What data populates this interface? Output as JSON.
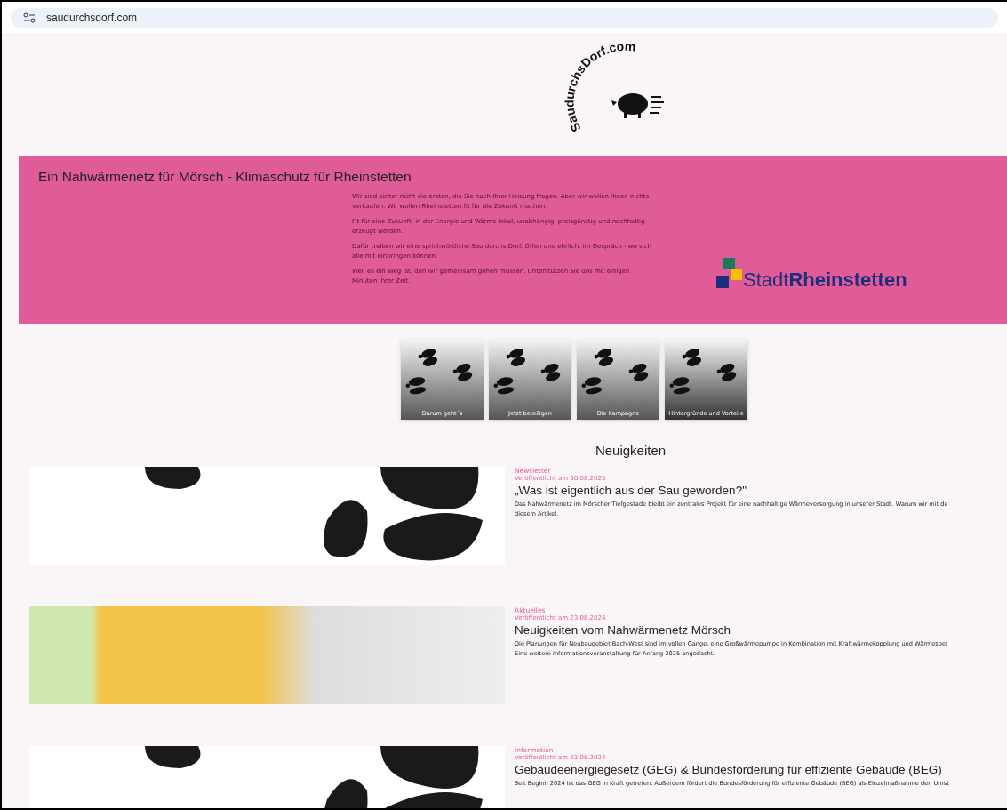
{
  "browser": {
    "url": "saudurchsdorf.com"
  },
  "logo": {
    "text": "SaudurchsDorf.com"
  },
  "banner": {
    "title": "Ein Nahwärmenetz für Mörsch - Klimaschutz für Rheinstetten",
    "paragraphs": [
      "Wir sind sicher nicht die ersten, die Sie nach Ihrer Heizung fragen. Aber wir wollen Ihnen nichts verkaufen. Wir wollen Rheinstetten fit für die Zukunft machen.",
      "Fit für eine Zukunft, in der Energie und Wärme lokal, unabhängig, preisgünstig und nachhaltig erzeugt werden.",
      "Dafür treiben wir eine sprichwörtliche Sau durchs Dorf. Offen und ehrlich, im Gespräch - wo sich alle mit einbringen können.",
      "Weil es ein Weg ist, den wir gemeinsam gehen müssen. Unterstützen Sie uns mit einigen Minuten Ihrer Zeit."
    ],
    "partner_logo": "Stadt**Rheinstetten**"
  },
  "tiles": [
    "Darum geht´s",
    "Jetzt beteiligen",
    "Die Kampagne",
    "Hintergründe und Vorteile"
  ],
  "news": {
    "heading": "Neuigkeiten",
    "items": [
      {
        "kind": "hoofprints",
        "category": "Newsletter",
        "date": "Veröffentlicht am 30.08.2025",
        "title": "„Was ist eigentlich aus der Sau geworden?\"",
        "lines": [
          "Das Nahwärmenetz im Mörscher Tiefgestade bleibt ein zentrales Projekt für eine nachhaltige Wärmeversorgung in unserer Stadt. Warum wir mit de",
          "diesem Artikel."
        ]
      },
      {
        "kind": "map",
        "category": "Aktuelles",
        "date": "Veröffentlicht am 23.08.2024",
        "title": "Neuigkeiten vom Nahwärmenetz Mörsch",
        "lines": [
          "Die Planungen für Neubaugebiet Bach-West sind im vollen Gange, eine Großwärmepumpe in Kombination mit Kraftwärmekopplung und Wärmespei",
          "Eine weitere Informationsveranstaltung für Anfang 2025 angedacht."
        ]
      },
      {
        "kind": "hoofprints",
        "category": "Information",
        "date": "Veröffentlicht am 23.08.2024",
        "title": "Gebäudeenergiegesetz (GEG) & Bundesförderung für effiziente Gebäude (BEG)",
        "lines": [
          "Seit Beginn 2024 ist das GEG in Kraft getreten. Außerdem fördert die Bundesförderung für effiziente Gebäude (BEG) als Einzelmaßnahme den Umst"
        ]
      }
    ]
  }
}
